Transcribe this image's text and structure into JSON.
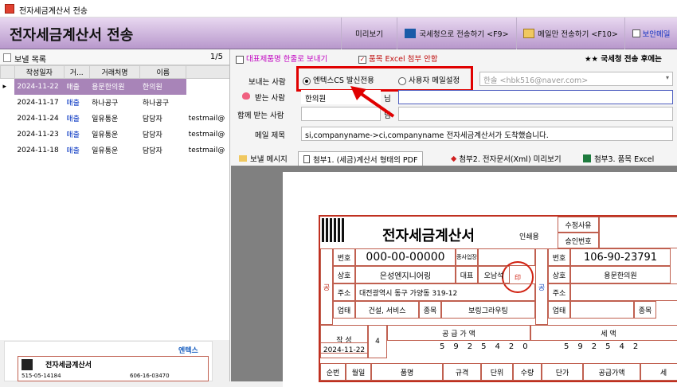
{
  "window": {
    "title": "전자세금계산서 전송"
  },
  "header": {
    "title": "전자세금계산서 전송",
    "preview_label": "미리보기",
    "send_nts_label": "국세청으로 전송하기 <F9>",
    "send_mail_label": "메일만 전송하기 <F10>",
    "secure_mail_label": "보안메일"
  },
  "list": {
    "title": "보낼 목록",
    "page": "1/5",
    "columns": [
      "작성일자",
      "거...",
      "거래처명",
      "이름"
    ],
    "rows": [
      {
        "date": "2024-11-22",
        "type": "매출",
        "partner": "용문한의원",
        "name": "한의원",
        "email": ""
      },
      {
        "date": "2024-11-17",
        "type": "매출",
        "partner": "하나공구",
        "name": "하나공구",
        "email": ""
      },
      {
        "date": "2024-11-24",
        "type": "매출",
        "partner": "일유통운",
        "name": "담당자",
        "email": "testmail@"
      },
      {
        "date": "2024-11-23",
        "type": "매출",
        "partner": "일유통운",
        "name": "담당자",
        "email": "testmail@"
      },
      {
        "date": "2024-11-18",
        "type": "매출",
        "partner": "일유통운",
        "name": "담당자",
        "email": "testmail@"
      }
    ]
  },
  "options": {
    "representative_item": "대표제품명 한줄로 보내기",
    "attach_excel": "품목 Excel 첨부 안함",
    "notice": "★★ 국세청 전송 후에는"
  },
  "form": {
    "sender_label": "보내는 사람",
    "sender_option1": "엔텍스CS 발신전용",
    "sender_option2": "사용자 메일설정",
    "sender_email_placeholder": "한솔 <hbk516@naver.com>",
    "receiver_label": "받는 사람",
    "receiver_name": "한의원",
    "receiver_suffix": "님",
    "cc_label": "함께 받는 사람",
    "cc_suffix": "님",
    "subject_label": "메일 제목",
    "subject_value": "si,companyname->ci,companyname 전자세금계산서가 도착했습니다."
  },
  "tabs": [
    "보낼 메시지",
    "첨부1. (세금)계산서 형태의 PDF",
    "첨부2. 전자문서(Xml) 미리보기",
    "첨부3. 품목 Excel"
  ],
  "invoice": {
    "title": "전자세금계산서",
    "stamp_label": "인쇄용",
    "revision_label": "수정사유",
    "approval_label": "승인번호",
    "supplier_reg_no": "000-00-00000",
    "buyer_reg_no": "106-90-23791",
    "supplier_company": "은성엔지니어링",
    "buyer_company": "용문한의원",
    "rep_label": "대표",
    "rep_name": "오남석",
    "address": "대전광역시 동구 가양동 319-12",
    "biz_type": "건설, 서비스",
    "biz_item": "보링그라우팅",
    "issue_date": "2024-11-22",
    "blank_count": "4",
    "supply_digits": [
      "5",
      "9",
      "2",
      "5",
      "4",
      "2",
      "0"
    ],
    "tax_digits": [
      "5",
      "9",
      "2",
      "5",
      "4",
      "2"
    ],
    "bottom_headers": [
      "순번",
      "월일",
      "품명",
      "규격",
      "단위",
      "수량",
      "단가",
      "공급가액",
      "세"
    ]
  },
  "thumbnail": {
    "title": "전자세금계산서",
    "reg_no": "515-05-14184",
    "buyer_no": "606-16-03470",
    "logo_text": "엔텍스"
  }
}
